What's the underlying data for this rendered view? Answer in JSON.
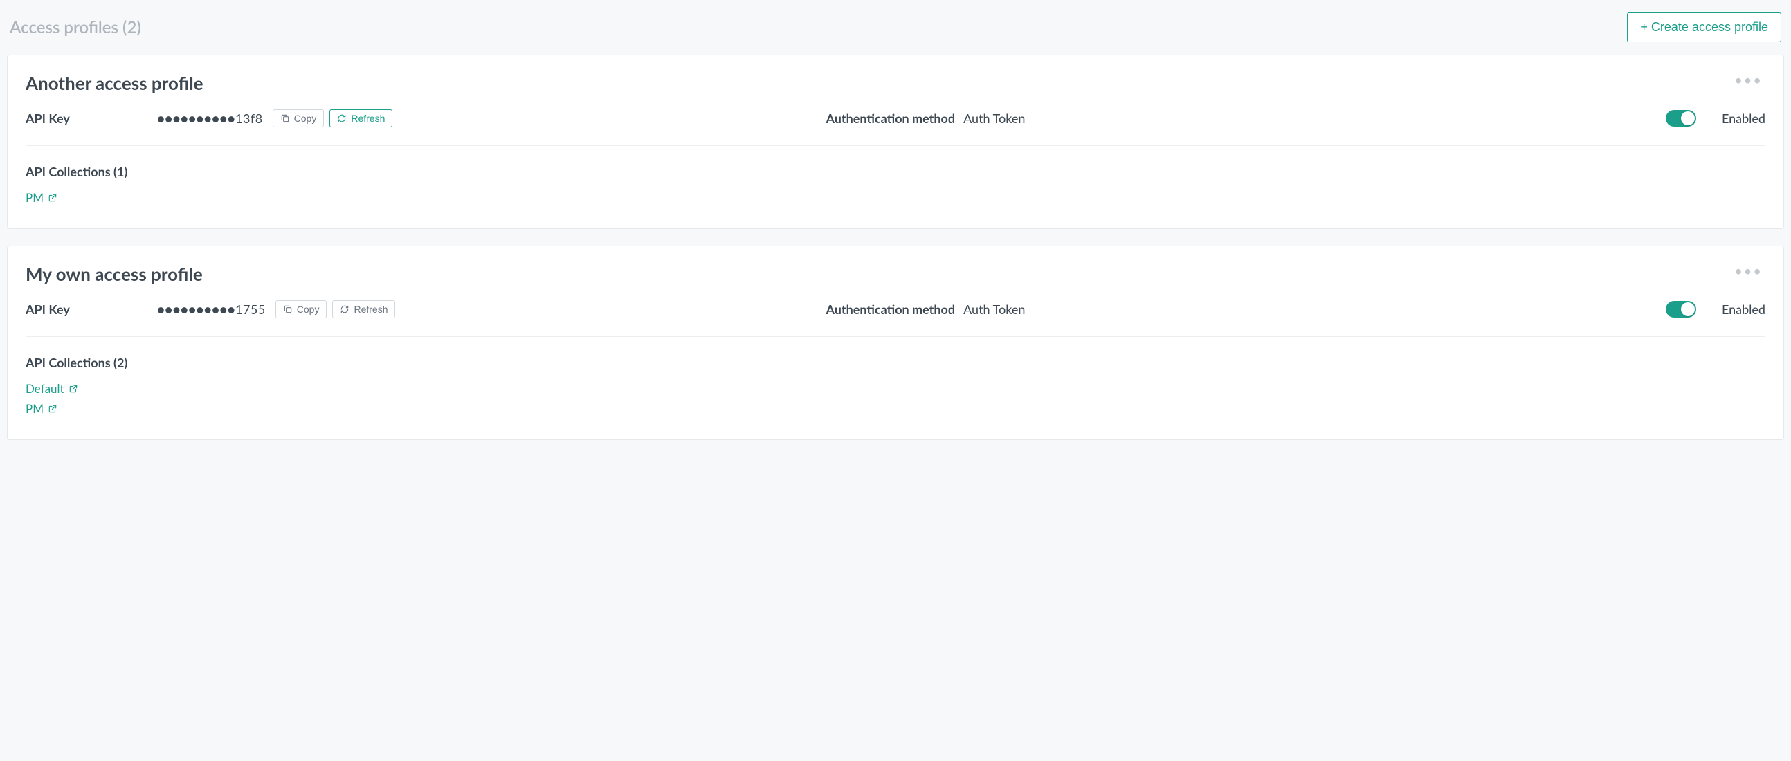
{
  "header": {
    "title": "Access profiles (2)",
    "create_label": "+ Create access profile"
  },
  "labels": {
    "api_key": "API Key",
    "auth_method": "Authentication method",
    "copy": "Copy",
    "refresh": "Refresh",
    "enabled": "Enabled"
  },
  "profiles": [
    {
      "title": "Another access profile",
      "masked_key": "●●●●●●●●●●13f8",
      "auth_value": "Auth Token",
      "refresh_accent": true,
      "enabled": true,
      "collections_title": "API Collections (1)",
      "collections": [
        "PM"
      ]
    },
    {
      "title": "My own access profile",
      "masked_key": "●●●●●●●●●●1755",
      "auth_value": "Auth Token",
      "refresh_accent": false,
      "enabled": true,
      "collections_title": "API Collections (2)",
      "collections": [
        "Default",
        "PM"
      ]
    }
  ]
}
